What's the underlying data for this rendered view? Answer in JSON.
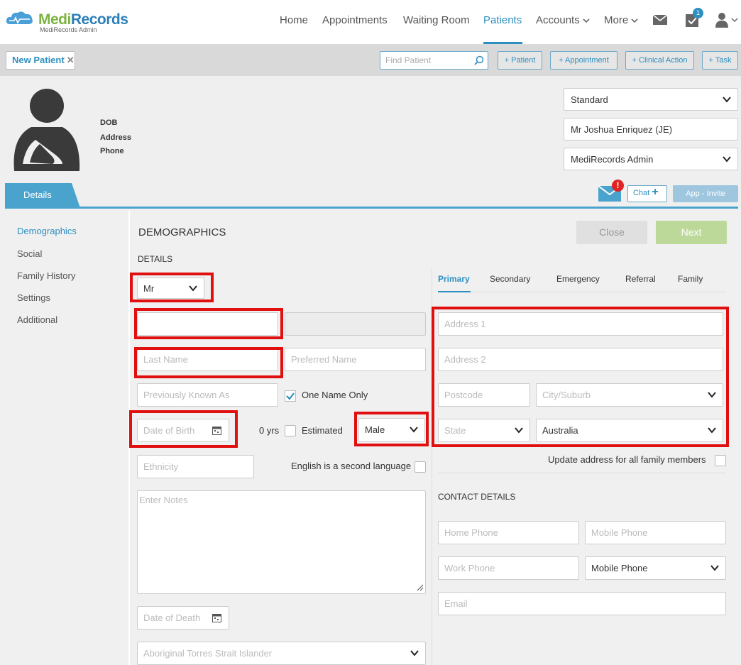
{
  "app": {
    "brand_a": "Medi",
    "brand_b": "Records",
    "subtitle": "MediRecords Admin"
  },
  "nav": {
    "home": "Home",
    "appointments": "Appointments",
    "waiting_room": "Waiting Room",
    "patients": "Patients",
    "accounts": "Accounts",
    "more": "More",
    "task_badge": "1"
  },
  "actionbar": {
    "tab_label": "New Patient",
    "search_placeholder": "Find Patient",
    "add_patient": "+ Patient",
    "add_appointment": "+ Appointment",
    "add_clinical": "+ Clinical Action",
    "add_task": "+ Task"
  },
  "patient": {
    "dob_label": "DOB",
    "address_label": "Address",
    "phone_label": "Phone",
    "billing_type": "Standard",
    "practitioner": "Mr Joshua Enriquez (JE)",
    "practice": "MediRecords Admin"
  },
  "tabs": {
    "details": "Details",
    "chat": "Chat",
    "app_invite": "App - Invite",
    "alert": "!"
  },
  "sidebar": {
    "items": [
      {
        "label": "Demographics"
      },
      {
        "label": "Social"
      },
      {
        "label": "Family History"
      },
      {
        "label": "Settings"
      },
      {
        "label": "Additional"
      }
    ]
  },
  "form": {
    "section_title": "DEMOGRAPHICS",
    "details_title": "DETAILS",
    "close": "Close",
    "next": "Next",
    "title_value": "Mr",
    "last_name_ph": "Last Name",
    "preferred_name_ph": "Preferred Name",
    "prev_known_ph": "Previously Known As",
    "one_name_only": "One Name Only",
    "dob_ph": "Date of Birth",
    "age": "0 yrs",
    "estimated": "Estimated",
    "gender_value": "Male",
    "ethnicity_ph": "Ethnicity",
    "esl": "English is a second language",
    "notes_ph": "Enter Notes",
    "dod_ph": "Date of Death",
    "atsi_ph": "Aboriginal Torres Strait Islander"
  },
  "address": {
    "tabs": [
      "Primary",
      "Secondary",
      "Emergency",
      "Referral",
      "Family"
    ],
    "address1_ph": "Address 1",
    "address2_ph": "Address 2",
    "postcode_ph": "Postcode",
    "city_ph": "City/Suburb",
    "state_ph": "State",
    "country_value": "Australia",
    "update_family": "Update address for all family members"
  },
  "contact": {
    "title": "CONTACT DETAILS",
    "home_phone_ph": "Home Phone",
    "mobile_phone_ph": "Mobile Phone",
    "work_phone_ph": "Work Phone",
    "preferred_phone_value": "Mobile Phone",
    "email_ph": "Email"
  },
  "colors": {
    "accent": "#2d8fc0",
    "brand_green": "#7cb342",
    "highlight": "#e01010",
    "next_button": "#bcd99a"
  }
}
